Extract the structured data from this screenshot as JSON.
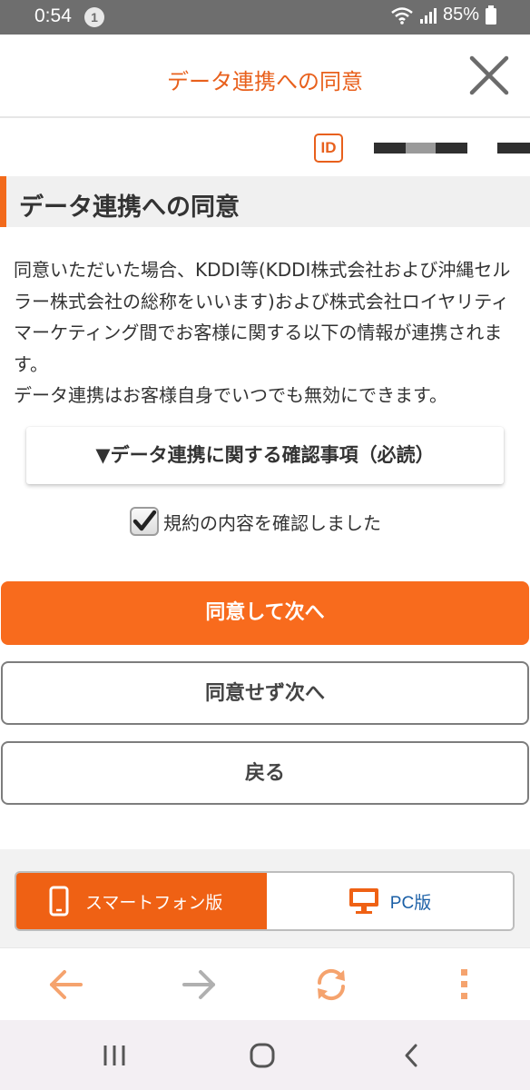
{
  "status_bar": {
    "time": "0:54",
    "notification_count": "1",
    "battery": "85%"
  },
  "header": {
    "title": "データ連携への同意"
  },
  "account": {
    "id_icon_text": "ID"
  },
  "section": {
    "heading": "データ連携への同意",
    "description_line1": "同意いただいた場合、KDDI等(KDDI株式会社および沖縄セルラー株式会社の総称をいいます)および株式会社ロイヤリティマーケティング間でお客様に関する以下の情報が連携されます。",
    "description_line2": "データ連携はお客様自身でいつでも無効にできます。"
  },
  "confirm_box": {
    "label": "▼データ連携に関する確認事項（必読）"
  },
  "checkbox": {
    "label": "規約の内容を確認しました",
    "checked": true
  },
  "buttons": {
    "agree": "同意して次へ",
    "disagree": "同意せず次へ",
    "back": "戻る"
  },
  "footer": {
    "smartphone_label": "スマートフォン版",
    "pc_label": "PC版"
  },
  "colors": {
    "accent": "#f86b1d",
    "title": "#e8601c",
    "pc_link": "#1a5fa6"
  }
}
